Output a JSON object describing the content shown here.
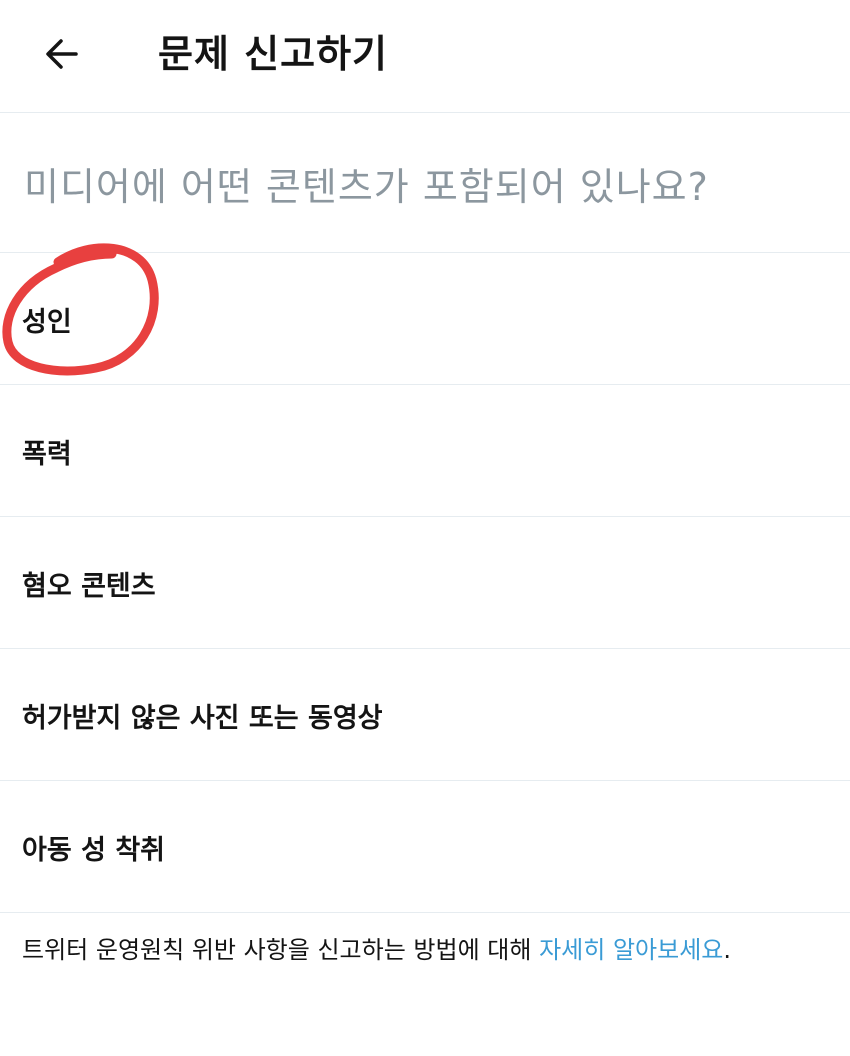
{
  "header": {
    "back_icon": "arrow-left-icon",
    "title": "문제 신고하기"
  },
  "question": "미디어에 어떤 콘텐츠가 포함되어 있나요?",
  "options": [
    {
      "label": "성인"
    },
    {
      "label": "폭력"
    },
    {
      "label": "혐오 콘텐츠"
    },
    {
      "label": "허가받지 않은 사진 또는 동영상"
    },
    {
      "label": "아동 성 착취"
    }
  ],
  "annotation": {
    "type": "hand-drawn-circle",
    "color": "#e8403f"
  },
  "footer": {
    "text": "트위터 운영원칙 위반 사항을 신고하는 방법에 대해 ",
    "link_text": "자세히 알아보세요",
    "end": "."
  },
  "colors": {
    "link": "#3a9bd5",
    "muted_text": "#8c979f",
    "divider": "#e6ecf0",
    "annotation": "#e8403f"
  }
}
